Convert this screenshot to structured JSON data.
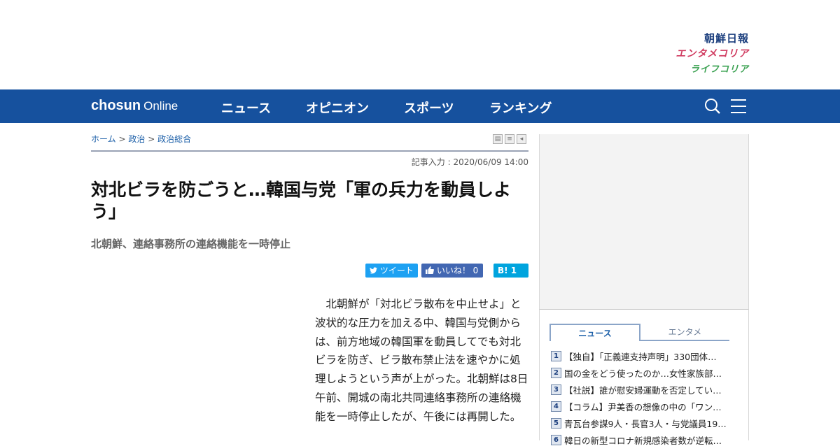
{
  "sister_sites": {
    "chosun_ilbo": "朝鮮日報",
    "entame_korea": "エンタメコリア",
    "life_korea": "ライフコリア"
  },
  "nav": {
    "logo_bold": "chosun",
    "logo_light": "Online",
    "items": [
      "ニュース",
      "オピニオン",
      "スポーツ",
      "ランキング"
    ]
  },
  "breadcrumb": {
    "home": "ホーム",
    "sep": ">",
    "section": "政治",
    "subsection": "政治総合"
  },
  "article": {
    "date": "記事入力 : 2020/06/09 14:00",
    "title": "対北ビラを防ごうと…韓国与党「軍の兵力を動員しよう」",
    "subtitle": "北朝鮮、連絡事務所の連絡機能を一時停止",
    "body": "北朝鮮が「対北ビラ散布を中止せよ」と波状的な圧力を加える中、韓国与党側からは、前方地域の韓国軍を動員してでも対北ビラを防ぎ、ビラ散布禁止法を速やかに処理しようという声が上がった。北朝鮮は8日午前、開城の南北共同連絡事務所の連絡機能を一時停止したが、午後には再開した。"
  },
  "share": {
    "tweet": "ツイート",
    "like": "いいね！ 0",
    "hatena": "B! 1"
  },
  "sidebar": {
    "tabs": [
      "ニュース",
      "エンタメ"
    ],
    "ranking": [
      {
        "num": "1",
        "text": "【独自】「正義連支持声明」330団体…"
      },
      {
        "num": "2",
        "text": "国の金をどう使ったのか…女性家族部…"
      },
      {
        "num": "3",
        "text": "【社説】誰が慰安婦運動を否定してい…"
      },
      {
        "num": "4",
        "text": "【コラム】尹美香の想像の中の「ワン…"
      },
      {
        "num": "5",
        "text": "青瓦台参謀9人・長官3人・与党議員19…"
      },
      {
        "num": "6",
        "text": "韓日の新型コロナ新規感染者数が逆転…"
      }
    ]
  },
  "colors": {
    "nav_bg": "#16519e",
    "twitter": "#1da1f2",
    "facebook": "#4267b2",
    "hatena": "#00a4de"
  }
}
